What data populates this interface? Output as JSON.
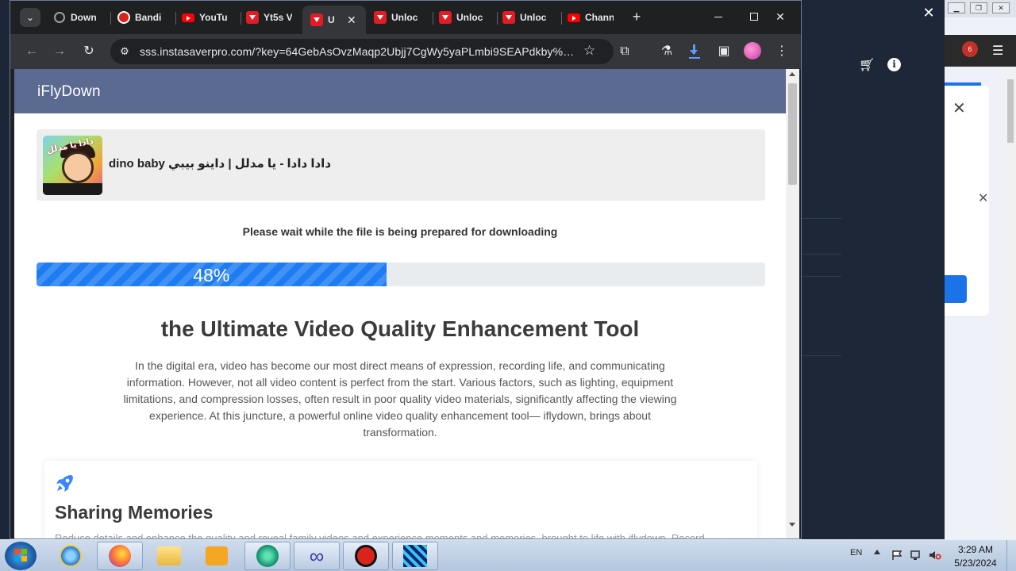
{
  "browser": {
    "tabs": [
      {
        "title": "Down",
        "icon": "globe-icon"
      },
      {
        "title": "Bandi",
        "icon": "record-icon"
      },
      {
        "title": "YouTu",
        "icon": "youtube-icon"
      },
      {
        "title": "Yt5s V",
        "icon": "download-icon"
      },
      {
        "title": "U",
        "icon": "download-icon",
        "active": true
      },
      {
        "title": "Unloc",
        "icon": "download-icon"
      },
      {
        "title": "Unloc",
        "icon": "download-icon"
      },
      {
        "title": "Unloc",
        "icon": "download-icon"
      },
      {
        "title": "Chann",
        "icon": "youtube-icon"
      }
    ],
    "url": "sss.instasaverpro.com/?key=64GebAsOvzMaqp2Ubjj7CgWy5yaPLmbi9SEAPdkby%2Frk...",
    "accent": "#35363a"
  },
  "page": {
    "logo": "iFlyDown",
    "header_color": "#5b6a90",
    "video_title": "دادا دادا - يا مدلل | داينو بيبي dino baby",
    "thumb_text": "دادا يا مدلل",
    "wait_message": "Please wait while the file is being prepared for downloading",
    "progress_percent": 48,
    "progress_label": "48%",
    "progress_color": "#1e7cf2",
    "heading": "the Ultimate Video Quality Enhancement Tool",
    "intro": "In the digital era, video has become our most direct means of expression, recording life, and communicating information. However, not all video content is perfect from the start. Various factors, such as lighting, equipment limitations, and compression losses, often result in poor quality video materials, significantly affecting the viewing experience. At this juncture, a powerful online video quality enhancement tool— iflydown, brings about transformation.",
    "feature": {
      "icon": "rocket-icon",
      "title": "Sharing Memories",
      "peek": "Reduce details and enhance the quality and reveal family videos and experience moments and memories, brought to life with iflydown. Record"
    }
  },
  "background_window": {
    "badge_count": "6",
    "lang": "EN"
  },
  "taskbar": {
    "lang": "EN",
    "time": "3:29 AM",
    "date": "5/23/2024"
  }
}
